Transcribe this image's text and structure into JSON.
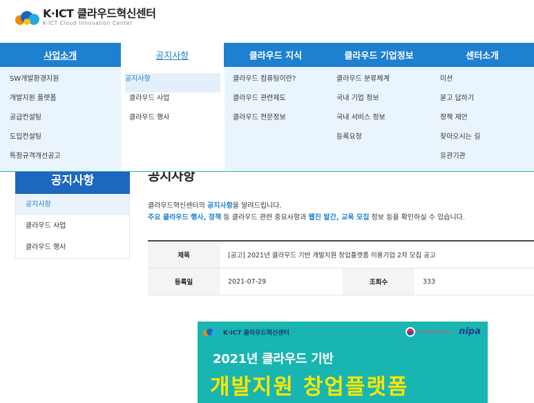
{
  "header": {
    "logo_main": "K·ICT 클라우드혁신센터",
    "logo_sub": "K-ICT Cloud Innovation Center"
  },
  "nav": {
    "tabs": [
      {
        "label": "사업소개"
      },
      {
        "label": "공지사항"
      },
      {
        "label": "클라우드 지식"
      },
      {
        "label": "클라우드 기업정보"
      },
      {
        "label": "센터소개"
      }
    ],
    "active_index": 1
  },
  "dropdown": {
    "columns": [
      {
        "items": [
          "SW개발환경지원",
          "개발지원 플랫폼",
          "공급컨설팅",
          "도입컨설팅",
          "특정규격개선공고"
        ]
      },
      {
        "items": [
          "공지사항",
          "클라우드 사업",
          "클라우드 행사"
        ]
      },
      {
        "items": [
          "클라우드 컴퓨팅이란?",
          "클라우드 관련제도",
          "클라우드 전문정보"
        ]
      },
      {
        "items": [
          "클라우드 분류체계",
          "국내 기업 정보",
          "국내 서비스 정보",
          "등록요청"
        ]
      },
      {
        "items": [
          "미션",
          "묻고 답하기",
          "정책 제안",
          "찾아오시는 길",
          "유관기관"
        ]
      }
    ]
  },
  "sidebar": {
    "title": "공지사항",
    "items": [
      "공지사항",
      "클라우드 사업",
      "클라우드 행사"
    ]
  },
  "main": {
    "title": "공지사항",
    "intro1_pre": "클라우드혁신센터의 ",
    "intro1_hl": "공지사항",
    "intro1_post": "을 알려드립니다.",
    "intro2_a": "주요 클라우드 행사, 정책",
    "intro2_b": " 등 클라우드 관련 중요사항과 ",
    "intro2_c": "웹진 발간, 교육 모집",
    "intro2_d": " 정보 등을 확인하실 수 있습니다.",
    "subject_label": "제목",
    "subject_value": "[공고] 2021년 클라우드 기반 개발지원 창업플랫폼 이용기업 2차 모집 공고",
    "date_label": "등록일",
    "date_value": "2021-07-29",
    "views_label": "조회수",
    "views_value": "333"
  },
  "banner": {
    "brand": "K·ICT 클라우드혁신센터",
    "gov": "과학기술정보통신부",
    "nipa": "nipa",
    "line1": "2021년 클라우드 기반",
    "line2": "개발지원 창업플랫폼",
    "colors": {
      "bg": "#19b5b0",
      "accent": "#ffe600"
    }
  }
}
